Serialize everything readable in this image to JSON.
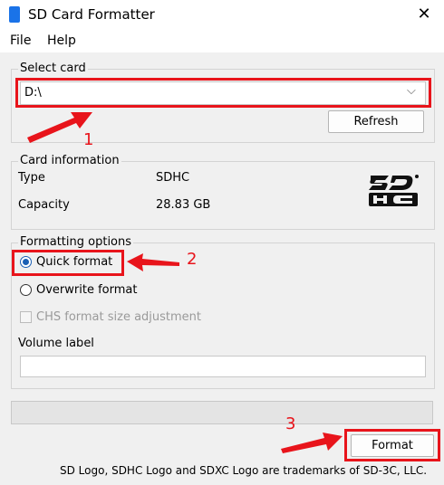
{
  "window": {
    "title": "SD Card Formatter",
    "close_glyph": "✕",
    "icon": "sd-card-icon"
  },
  "menu": {
    "items": [
      "File",
      "Help"
    ]
  },
  "select_card": {
    "legend": "Select card",
    "selected": "D:\\",
    "chevron": "⌵",
    "refresh_label": "Refresh"
  },
  "card_info": {
    "legend": "Card information",
    "type_label": "Type",
    "type_value": "SDHC",
    "capacity_label": "Capacity",
    "capacity_value": "28.83 GB",
    "logo": "sdhc-logo"
  },
  "formatting": {
    "legend": "Formatting options",
    "quick_format": "Quick format",
    "overwrite_format": "Overwrite format",
    "chs_adjust": "CHS format size adjustment",
    "volume_label_caption": "Volume label",
    "volume_label_value": "",
    "selected_option": "Quick format"
  },
  "actions": {
    "format_label": "Format"
  },
  "progress": {
    "value": 0
  },
  "footer": {
    "text": "SD Logo, SDHC Logo and SDXC Logo are trademarks of SD-3C, LLC."
  },
  "annotations": {
    "n1": "1",
    "n2": "2",
    "n3": "3"
  },
  "colors": {
    "annotation_red": "#e8141b",
    "radio_accent": "#1a5fb4",
    "icon_blue": "#1a73e8"
  }
}
